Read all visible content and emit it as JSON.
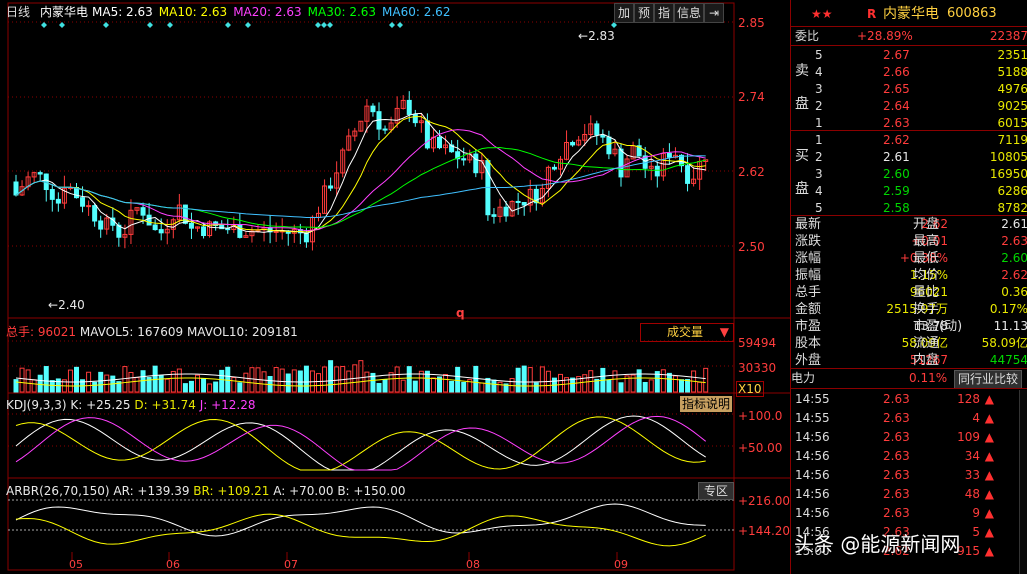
{
  "header": {
    "period": "日线",
    "name": "内蒙华电",
    "ma": [
      {
        "label": "MA5: 2.63",
        "color": "#ffffff"
      },
      {
        "label": "MA10: 2.63",
        "color": "#ffff00"
      },
      {
        "label": "MA20: 2.63",
        "color": "#ff40ff"
      },
      {
        "label": "MA30: 2.63",
        "color": "#00ff00"
      },
      {
        "label": "MA60: 2.62",
        "color": "#40c0ff"
      }
    ],
    "buttons": [
      "加",
      "预",
      "指",
      "信息"
    ]
  },
  "price_chart": {
    "y_ticks": [
      "2.85",
      "2.74",
      "2.62",
      "2.50"
    ],
    "high_label": "2.83",
    "low_label": "2.40",
    "marker": "q"
  },
  "volume": {
    "label_prefix": "总手: ",
    "value": "96021",
    "mavol5": "MAVOL5: 167609",
    "mavol10": "MAVOL10: 209181",
    "dropdown": "成交量",
    "y_ticks": [
      "59494",
      "30330"
    ],
    "unit": "X10"
  },
  "kdj": {
    "title": "KDJ(9,3,3)",
    "k": "K: +25.25",
    "d": "D: +31.74",
    "j": "J: +12.28",
    "btn": "指标说明",
    "y_ticks": [
      "+100.0",
      "+50.00"
    ]
  },
  "arbr": {
    "title": "ARBR(26,70,150)",
    "ar": "AR: +139.39",
    "br": "BR: +109.21",
    "a": "A: +70.00",
    "b": "B: +150.00",
    "btn": "专区",
    "y_ticks": [
      "+216.00",
      "+144.20"
    ]
  },
  "x_dates": [
    "05",
    "06",
    "07",
    "08",
    "09"
  ],
  "panel": {
    "title": "内蒙华电",
    "code": "600863",
    "r_mark": "R",
    "weibi_label": "委比",
    "weibi_pct": "+28.89%",
    "weibi_val": "22387",
    "sell_label": [
      "卖",
      "盘"
    ],
    "buy_label": [
      "买",
      "盘"
    ],
    "asks": [
      {
        "lvl": "5",
        "price": "2.67",
        "vol": "2351"
      },
      {
        "lvl": "4",
        "price": "2.66",
        "vol": "5188"
      },
      {
        "lvl": "3",
        "price": "2.65",
        "vol": "4976"
      },
      {
        "lvl": "2",
        "price": "2.64",
        "vol": "9025"
      },
      {
        "lvl": "1",
        "price": "2.63",
        "vol": "6015"
      }
    ],
    "bids": [
      {
        "lvl": "1",
        "price": "2.62",
        "vol": "7119"
      },
      {
        "lvl": "2",
        "price": "2.61",
        "vol": "10805"
      },
      {
        "lvl": "3",
        "price": "2.60",
        "vol": "16950"
      },
      {
        "lvl": "4",
        "price": "2.59",
        "vol": "6286"
      },
      {
        "lvl": "5",
        "price": "2.58",
        "vol": "8782"
      }
    ],
    "stats": [
      {
        "l1": "最新",
        "v1": "2.62",
        "c1": "red",
        "l2": "开盘",
        "v2": "2.61",
        "c2": "wht"
      },
      {
        "l1": "涨跌",
        "v1": "+0.01",
        "c1": "red",
        "l2": "最高",
        "v2": "2.63",
        "c2": "red"
      },
      {
        "l1": "涨幅",
        "v1": "+0.38%",
        "c1": "red",
        "l2": "最低",
        "v2": "2.60",
        "c2": "grn"
      },
      {
        "l1": "振幅",
        "v1": "1.15%",
        "c1": "yel",
        "l2": "均价",
        "v2": "2.62",
        "c2": "red"
      },
      {
        "l1": "总手",
        "v1": "96021",
        "c1": "yel",
        "l2": "量比",
        "v2": "0.36",
        "c2": "yel"
      },
      {
        "l1": "金额",
        "v1": "2515.97万",
        "c1": "yel",
        "l2": "换手",
        "v2": "0.17%",
        "c2": "yel"
      },
      {
        "l1": "市盈",
        "v1": "13.78",
        "c1": "wht",
        "l2": "市盈(动)",
        "v2": "11.13",
        "c2": "wht"
      },
      {
        "l1": "股本",
        "v1": "58.09亿",
        "c1": "yel",
        "l2": "流通",
        "v2": "58.09亿",
        "c2": "yel"
      },
      {
        "l1": "外盘",
        "v1": "51267",
        "c1": "red",
        "l2": "内盘",
        "v2": "44754",
        "c2": "grn"
      }
    ],
    "industry": "电力",
    "industry_pct": "0.11%",
    "compare_btn": "同行业比较",
    "ticks": [
      {
        "t": "14:55",
        "p": "2.63",
        "v": "128"
      },
      {
        "t": "14:55",
        "p": "2.63",
        "v": "4"
      },
      {
        "t": "14:56",
        "p": "2.63",
        "v": "109"
      },
      {
        "t": "14:56",
        "p": "2.63",
        "v": "34"
      },
      {
        "t": "14:56",
        "p": "2.63",
        "v": "33"
      },
      {
        "t": "14:56",
        "p": "2.63",
        "v": "48"
      },
      {
        "t": "14:56",
        "p": "2.63",
        "v": "9"
      },
      {
        "t": "14:56",
        "p": "2.63",
        "v": "5"
      },
      {
        "t": "15:00",
        "p": "2.62",
        "v": "915"
      }
    ]
  },
  "watermark": "头条 @能源新闻网",
  "colors": {
    "up": "#ff3c3c",
    "down": "#54ffff",
    "grid": "#8b0000",
    "bg": "#000000"
  }
}
